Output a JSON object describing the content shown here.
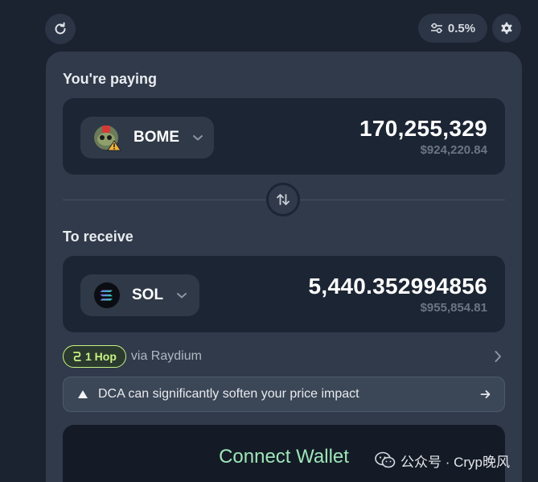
{
  "header": {
    "slippage_label": "0.5%"
  },
  "pay": {
    "section_label": "You're paying",
    "token_symbol": "BOME",
    "amount": "170,255,329",
    "usd_value": "$924,220.84"
  },
  "receive": {
    "section_label": "To receive",
    "token_symbol": "SOL",
    "amount": "5,440.352994856",
    "usd_value": "$955,854.81"
  },
  "route": {
    "hop_label": "1 Hop",
    "via_label": "via Raydium"
  },
  "dca_notice": {
    "text": "DCA can significantly soften your price impact"
  },
  "connect_button": {
    "label": "Connect Wallet"
  },
  "watermark": {
    "text": "公众号 · Cryp晚风"
  },
  "colors": {
    "background": "#1b2230",
    "card": "#303a4a",
    "input_box": "#1c2533",
    "accent_green": "#c7f284",
    "connect_text": "#9ee5b8"
  },
  "icons": [
    "refresh-icon",
    "sliders-icon",
    "gear-icon",
    "bome-token-icon",
    "sol-token-icon",
    "chevron-down-icon",
    "swap-arrows-icon",
    "route-icon",
    "chevron-right-icon",
    "warning-triangle-icon",
    "arrow-right-icon",
    "wechat-icon"
  ]
}
